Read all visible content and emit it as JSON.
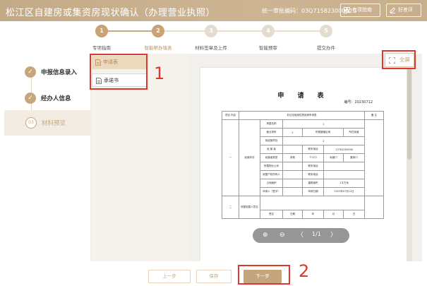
{
  "header": {
    "title": "松江区自建房或集资房现状确认（办理营业执照）",
    "code": "统一审批编码：03Q71582300002G",
    "guide_label": "专项指南",
    "rate_label": "好差评"
  },
  "steps": [
    {
      "num": "1",
      "label": "专项指南",
      "state": "done"
    },
    {
      "num": "2",
      "label": "智能帮办填表",
      "state": "current"
    },
    {
      "num": "3",
      "label": "材料签章及上传",
      "state": "todo"
    },
    {
      "num": "4",
      "label": "智能预审",
      "state": "todo"
    },
    {
      "num": "5",
      "label": "提交办件",
      "state": "todo"
    }
  ],
  "sidebar": {
    "items": [
      {
        "label": "申报信息录入",
        "icon": "check-icon",
        "mark": "✓"
      },
      {
        "label": "经办人信息",
        "icon": "check-icon",
        "mark": "✓"
      },
      {
        "label": "材料预览",
        "icon": "step-number-icon",
        "mark": "03"
      }
    ]
  },
  "files": [
    {
      "label": "申请表",
      "selected": true
    },
    {
      "label": "承诺书",
      "selected": false
    }
  ],
  "annotations": {
    "one": "1",
    "two": "2"
  },
  "viewer": {
    "fullscreen_label": "全屏",
    "doc_title": "申 请 表",
    "doc_no": "编号：20230712",
    "page_indicator": "1/1",
    "zoom_in": "⊕",
    "zoom_out": "⊖",
    "prev": "〈",
    "next": "〉"
  },
  "form": {
    "header_left": "项目 内容",
    "header_mid": "非住宅使用性质用房申请表",
    "header_right": "备 注",
    "rows": [
      [
        "房屋名称",
        "1"
      ],
      [
        "营业场所",
        "2",
        "所属管辖区域",
        "所在街道"
      ],
      [
        "拟经营项目",
        "2"
      ],
      [
        "经 营 者",
        "",
        "联系电话",
        "13761005598"
      ],
      [
        "经营者类型",
        "其他",
        "个人口",
        "私营口",
        "集体口"
      ],
      [
        "所属物业公司",
        "",
        "联系电话",
        ""
      ],
      [
        "房屋产权所有人",
        "",
        "联系电话",
        ""
      ],
      [
        "占地面积",
        "",
        "建筑面积",
        "1平方米"
      ],
      [
        "申请人（签字）",
        "",
        "申请日期",
        "2023年07月12日"
      ]
    ],
    "group_one": "一",
    "group_one_label": "经营状况",
    "group_two": "二",
    "group_two_label": "房屋权属人意见",
    "sign_row": [
      "签名",
      "日期",
      "年",
      "月",
      "日"
    ]
  },
  "actions": {
    "prev": "上一步",
    "save": "保存",
    "next": "下一步"
  },
  "colors": {
    "brand": "#c4a57d",
    "highlight": "#e0372d"
  }
}
